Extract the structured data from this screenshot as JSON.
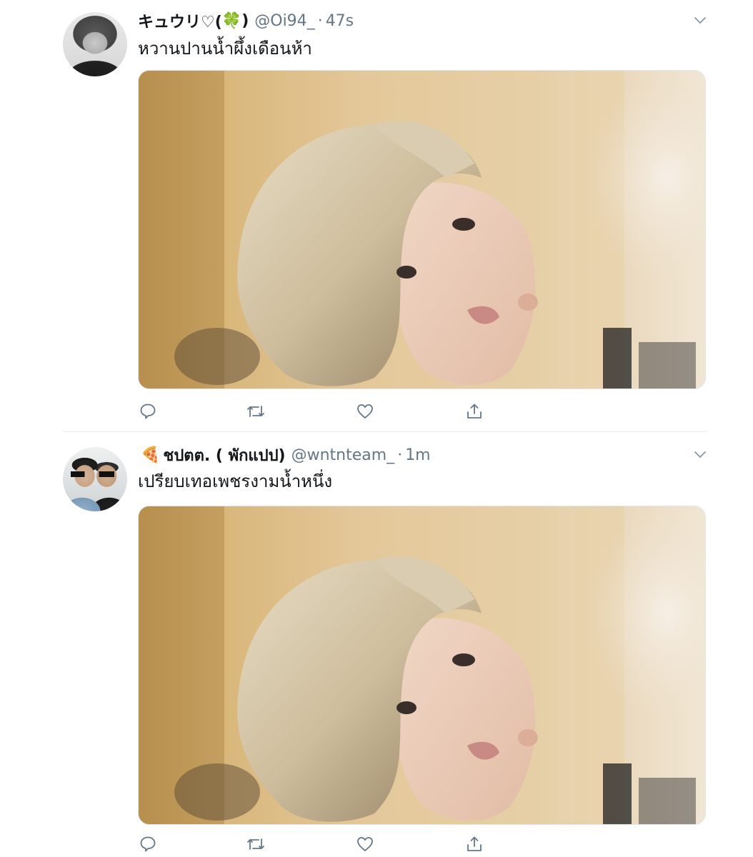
{
  "tweets": [
    {
      "display_name": "キュウリ♡(",
      "emoji": "🍀",
      "display_name_suffix": ")",
      "handle": "@Oi94_",
      "separator": "·",
      "time": "47s",
      "text": "หวานปานน้ำผึ้งเดือนห้า",
      "avatar_icon": "profile-avatar",
      "media_description": "photo"
    },
    {
      "emoji": "🍕",
      "display_name": "ชปตต. ( พักแปป)",
      "handle": "@wntnteam_",
      "separator": "·",
      "time": "1m",
      "text": "เปรียบเทอเพชรงามน้ำหนึ่ง",
      "avatar_icon": "profile-avatar",
      "media_description": "photo"
    }
  ],
  "actions": [
    "reply-icon",
    "retweet-icon",
    "like-icon",
    "share-icon"
  ],
  "colors": {
    "text": "#14171a",
    "secondary": "#657786",
    "divider": "#e6ecf0"
  }
}
